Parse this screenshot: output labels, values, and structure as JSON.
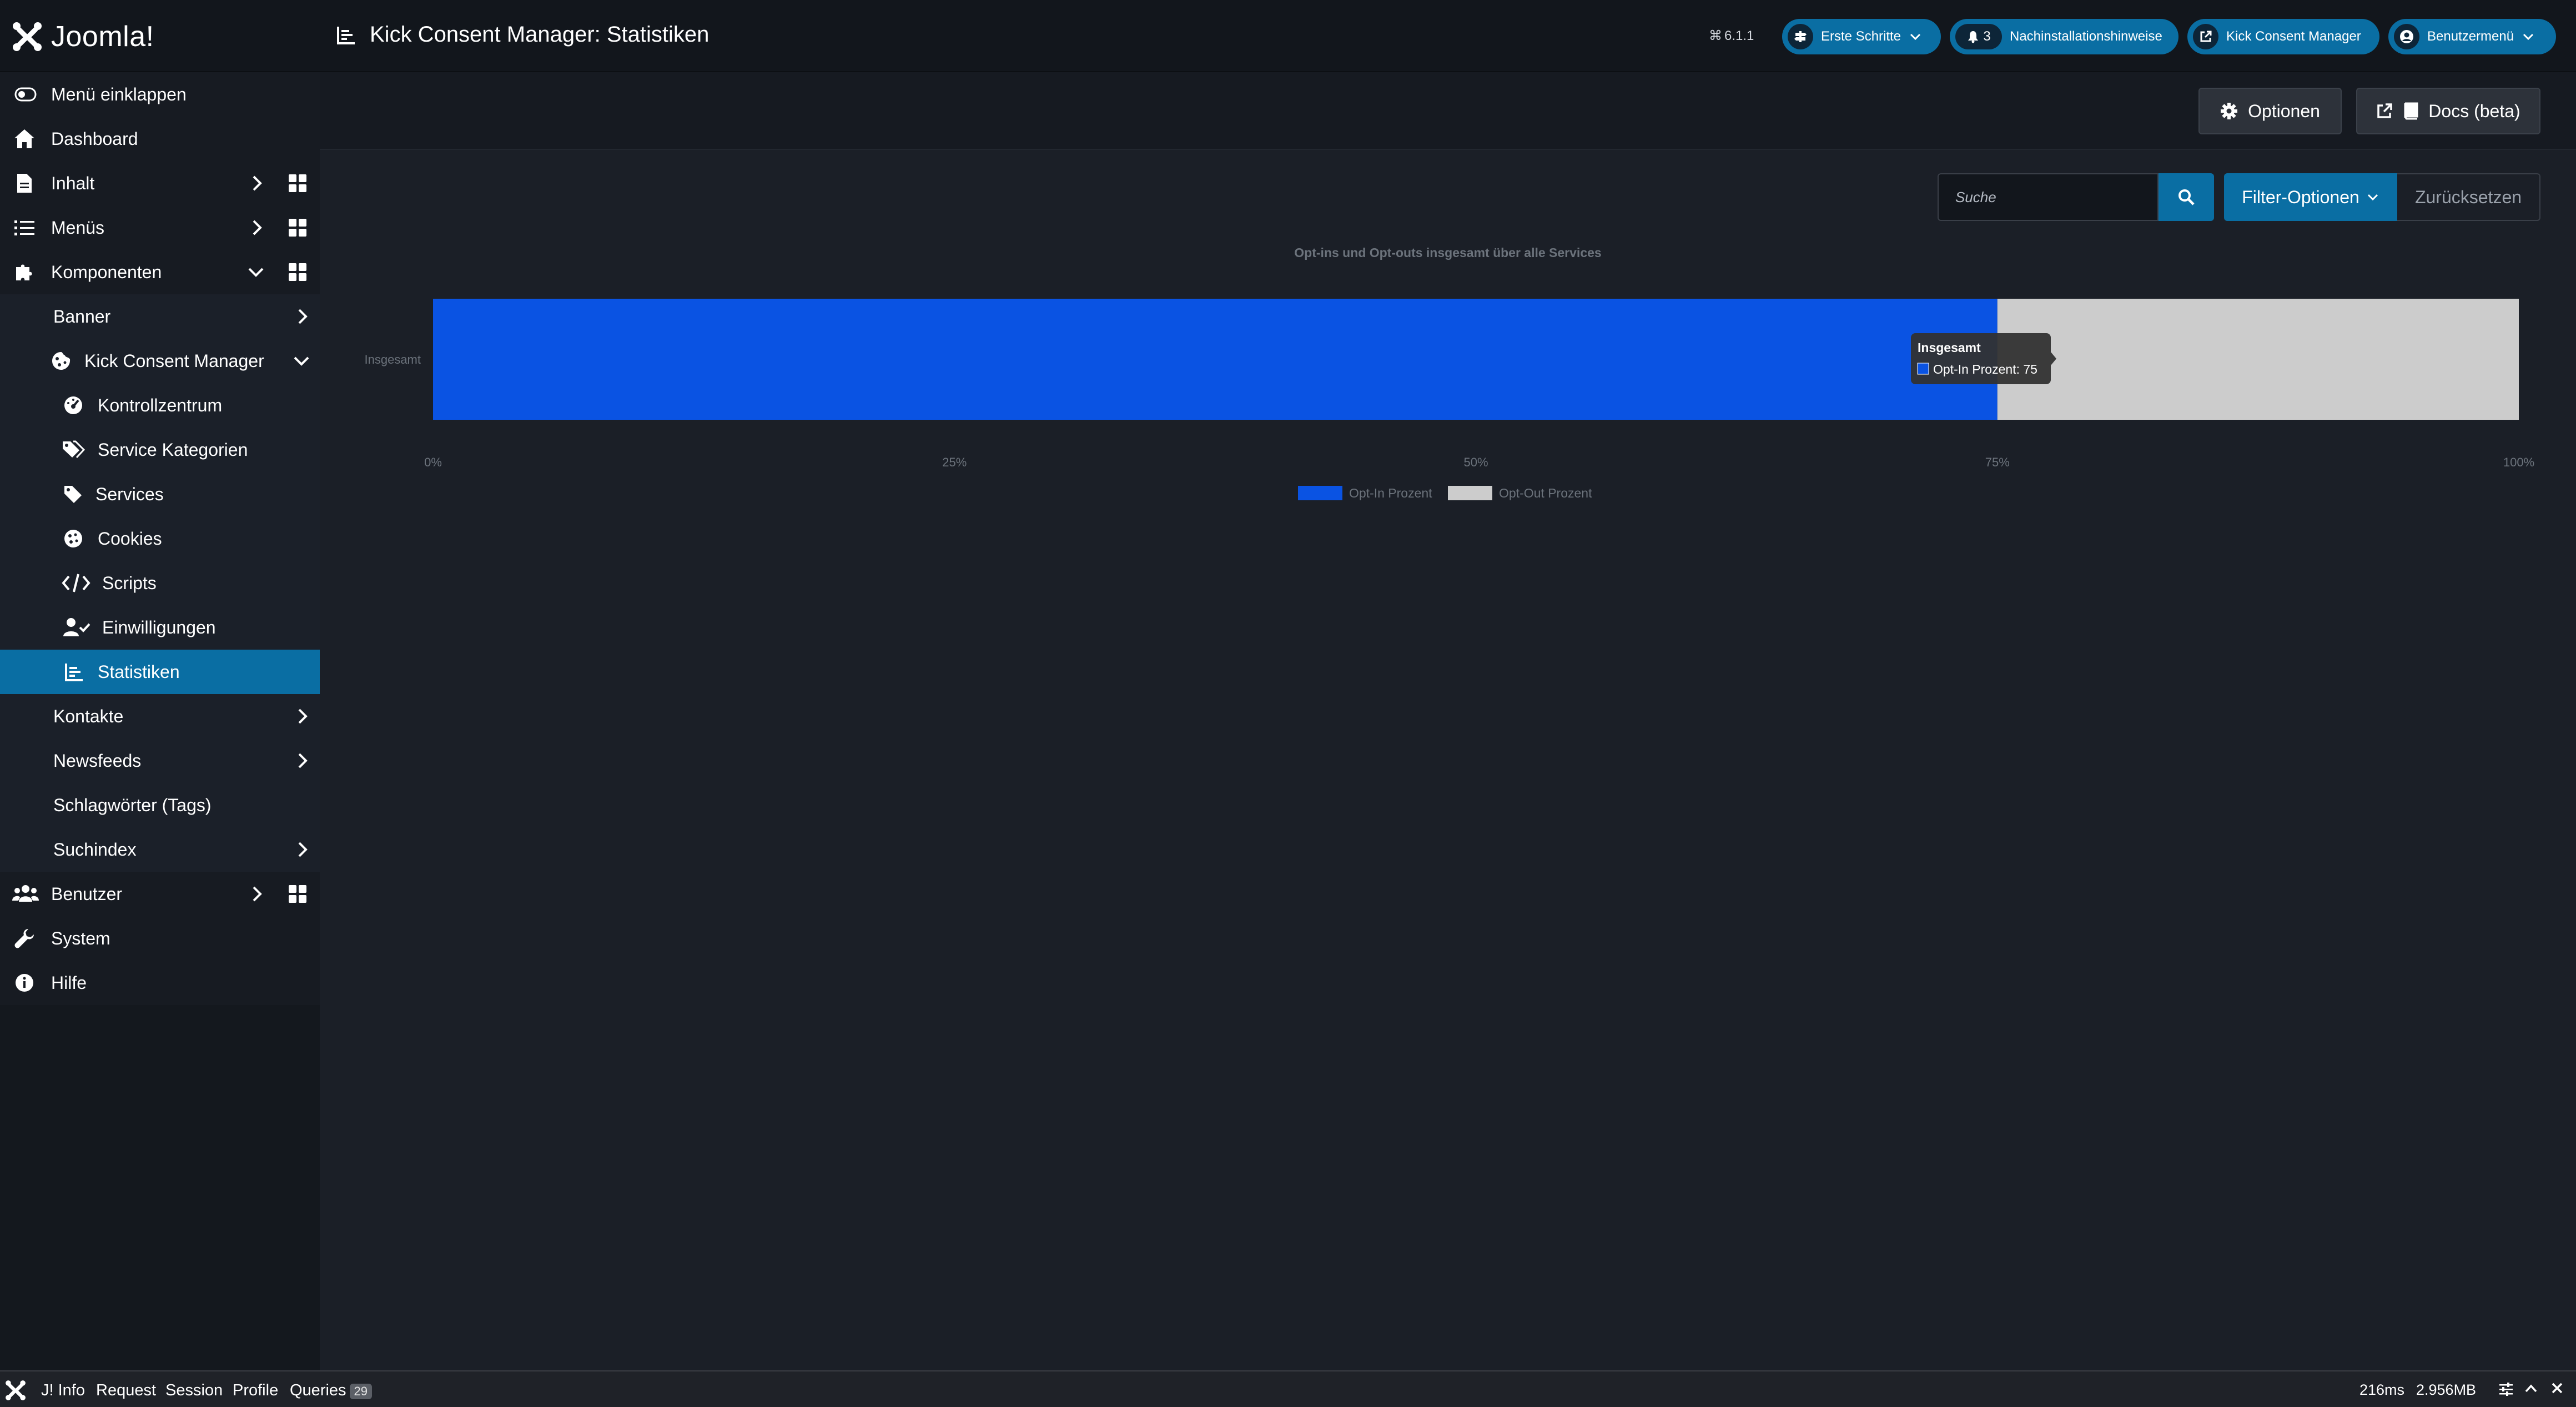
{
  "header": {
    "brand": "Joomla!",
    "page_title": "Kick Consent Manager: Statistiken",
    "version": "6.1.1",
    "guided_tours_label": "Erste Schritte",
    "notifications_count": "3",
    "post_install_label": "Nachinstallationshinweise",
    "site_label": "Kick Consent Manager",
    "user_menu_label": "Benutzermenü"
  },
  "sidebar": {
    "toggle_label": "Menü einklappen",
    "items": {
      "dashboard": "Dashboard",
      "content": "Inhalt",
      "menus": "Menüs",
      "components": "Komponenten",
      "banners": "Banner",
      "kick_consent_manager": "Kick Consent Manager",
      "control_center": "Kontrollzentrum",
      "service_categories": "Service Kategorien",
      "services": "Services",
      "cookies": "Cookies",
      "scripts": "Scripts",
      "consents": "Einwilligungen",
      "statistics": "Statistiken",
      "contacts": "Kontakte",
      "newsfeeds": "Newsfeeds",
      "tags": "Schlagwörter (Tags)",
      "smart_search": "Suchindex",
      "users": "Benutzer",
      "system": "System",
      "help": "Hilfe"
    }
  },
  "toolbar": {
    "options_label": "Optionen",
    "docs_label": "Docs (beta)"
  },
  "filters": {
    "search_placeholder": "Suche",
    "filter_options_label": "Filter-Optionen",
    "reset_label": "Zurücksetzen"
  },
  "chart_data": {
    "type": "bar",
    "orientation": "horizontal",
    "stacked": true,
    "title": "Opt-ins und Opt-outs insgesamt über alle Services",
    "categories": [
      "Insgesamt"
    ],
    "series": [
      {
        "name": "Opt-In Prozent",
        "values": [
          75
        ],
        "color": "#0a53e3"
      },
      {
        "name": "Opt-Out Prozent",
        "values": [
          25
        ],
        "color": "#cccccc"
      }
    ],
    "xlim": [
      0,
      100
    ],
    "x_ticks": [
      "0%",
      "25%",
      "50%",
      "75%",
      "100%"
    ],
    "legend_position": "bottom",
    "grid": false,
    "tooltip": {
      "title": "Insgesamt",
      "text": "Opt-In Prozent: 75"
    }
  },
  "debugbar": {
    "tabs": [
      "J! Info",
      "Request",
      "Session",
      "Profile",
      "Queries"
    ],
    "queries_count": "29",
    "time": "216ms",
    "memory": "2.956MB"
  }
}
